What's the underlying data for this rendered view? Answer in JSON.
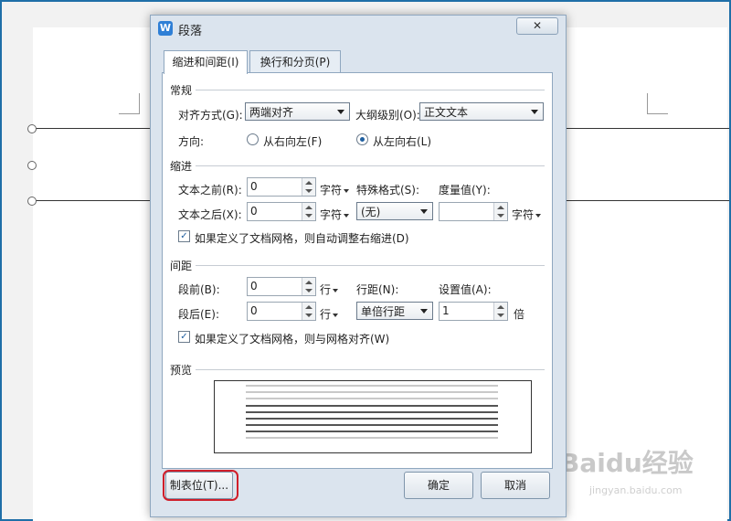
{
  "dialog": {
    "title": "段落",
    "app_icon_letter": "W",
    "close_symbol": "✕",
    "tabs": [
      {
        "label": "缩进和间距(I)",
        "active": true
      },
      {
        "label": "换行和分页(P)",
        "active": false
      }
    ]
  },
  "general": {
    "title": "常规",
    "align_label": "对齐方式(G):",
    "align_value": "两端对齐",
    "outline_label": "大纲级别(O):",
    "outline_value": "正文文本",
    "direction_label": "方向:",
    "rtl_label": "从右向左(F)",
    "ltr_label": "从左向右(L)",
    "ltr_selected": true
  },
  "indent": {
    "title": "缩进",
    "before_label": "文本之前(R):",
    "before_value": "0",
    "before_unit": "字符",
    "after_label": "文本之后(X):",
    "after_value": "0",
    "after_unit": "字符",
    "special_label": "特殊格式(S):",
    "special_value": "(无)",
    "measure_label": "度量值(Y):",
    "measure_value": "",
    "measure_unit": "字符",
    "auto_adjust_label": "如果定义了文档网格，则自动调整右缩进(D)",
    "auto_adjust_checked": true
  },
  "spacing": {
    "title": "间距",
    "before_label": "段前(B):",
    "before_value": "0",
    "before_unit": "行",
    "after_label": "段后(E):",
    "after_value": "0",
    "after_unit": "行",
    "line_spacing_label": "行距(N):",
    "line_spacing_value": "单倍行距",
    "setting_label": "设置值(A):",
    "setting_value": "1",
    "setting_unit": "倍",
    "snap_grid_label": "如果定义了文档网格，则与网格对齐(W)",
    "snap_grid_checked": true
  },
  "preview": {
    "title": "预览"
  },
  "buttons": {
    "tabs": "制表位(T)...",
    "ok": "确定",
    "cancel": "取消"
  },
  "watermark": {
    "text": "Baidu经验",
    "sub": "jingyan.baidu.com"
  },
  "colors": {
    "highlight": "#d01e2a",
    "accent": "#1f5fa0"
  }
}
